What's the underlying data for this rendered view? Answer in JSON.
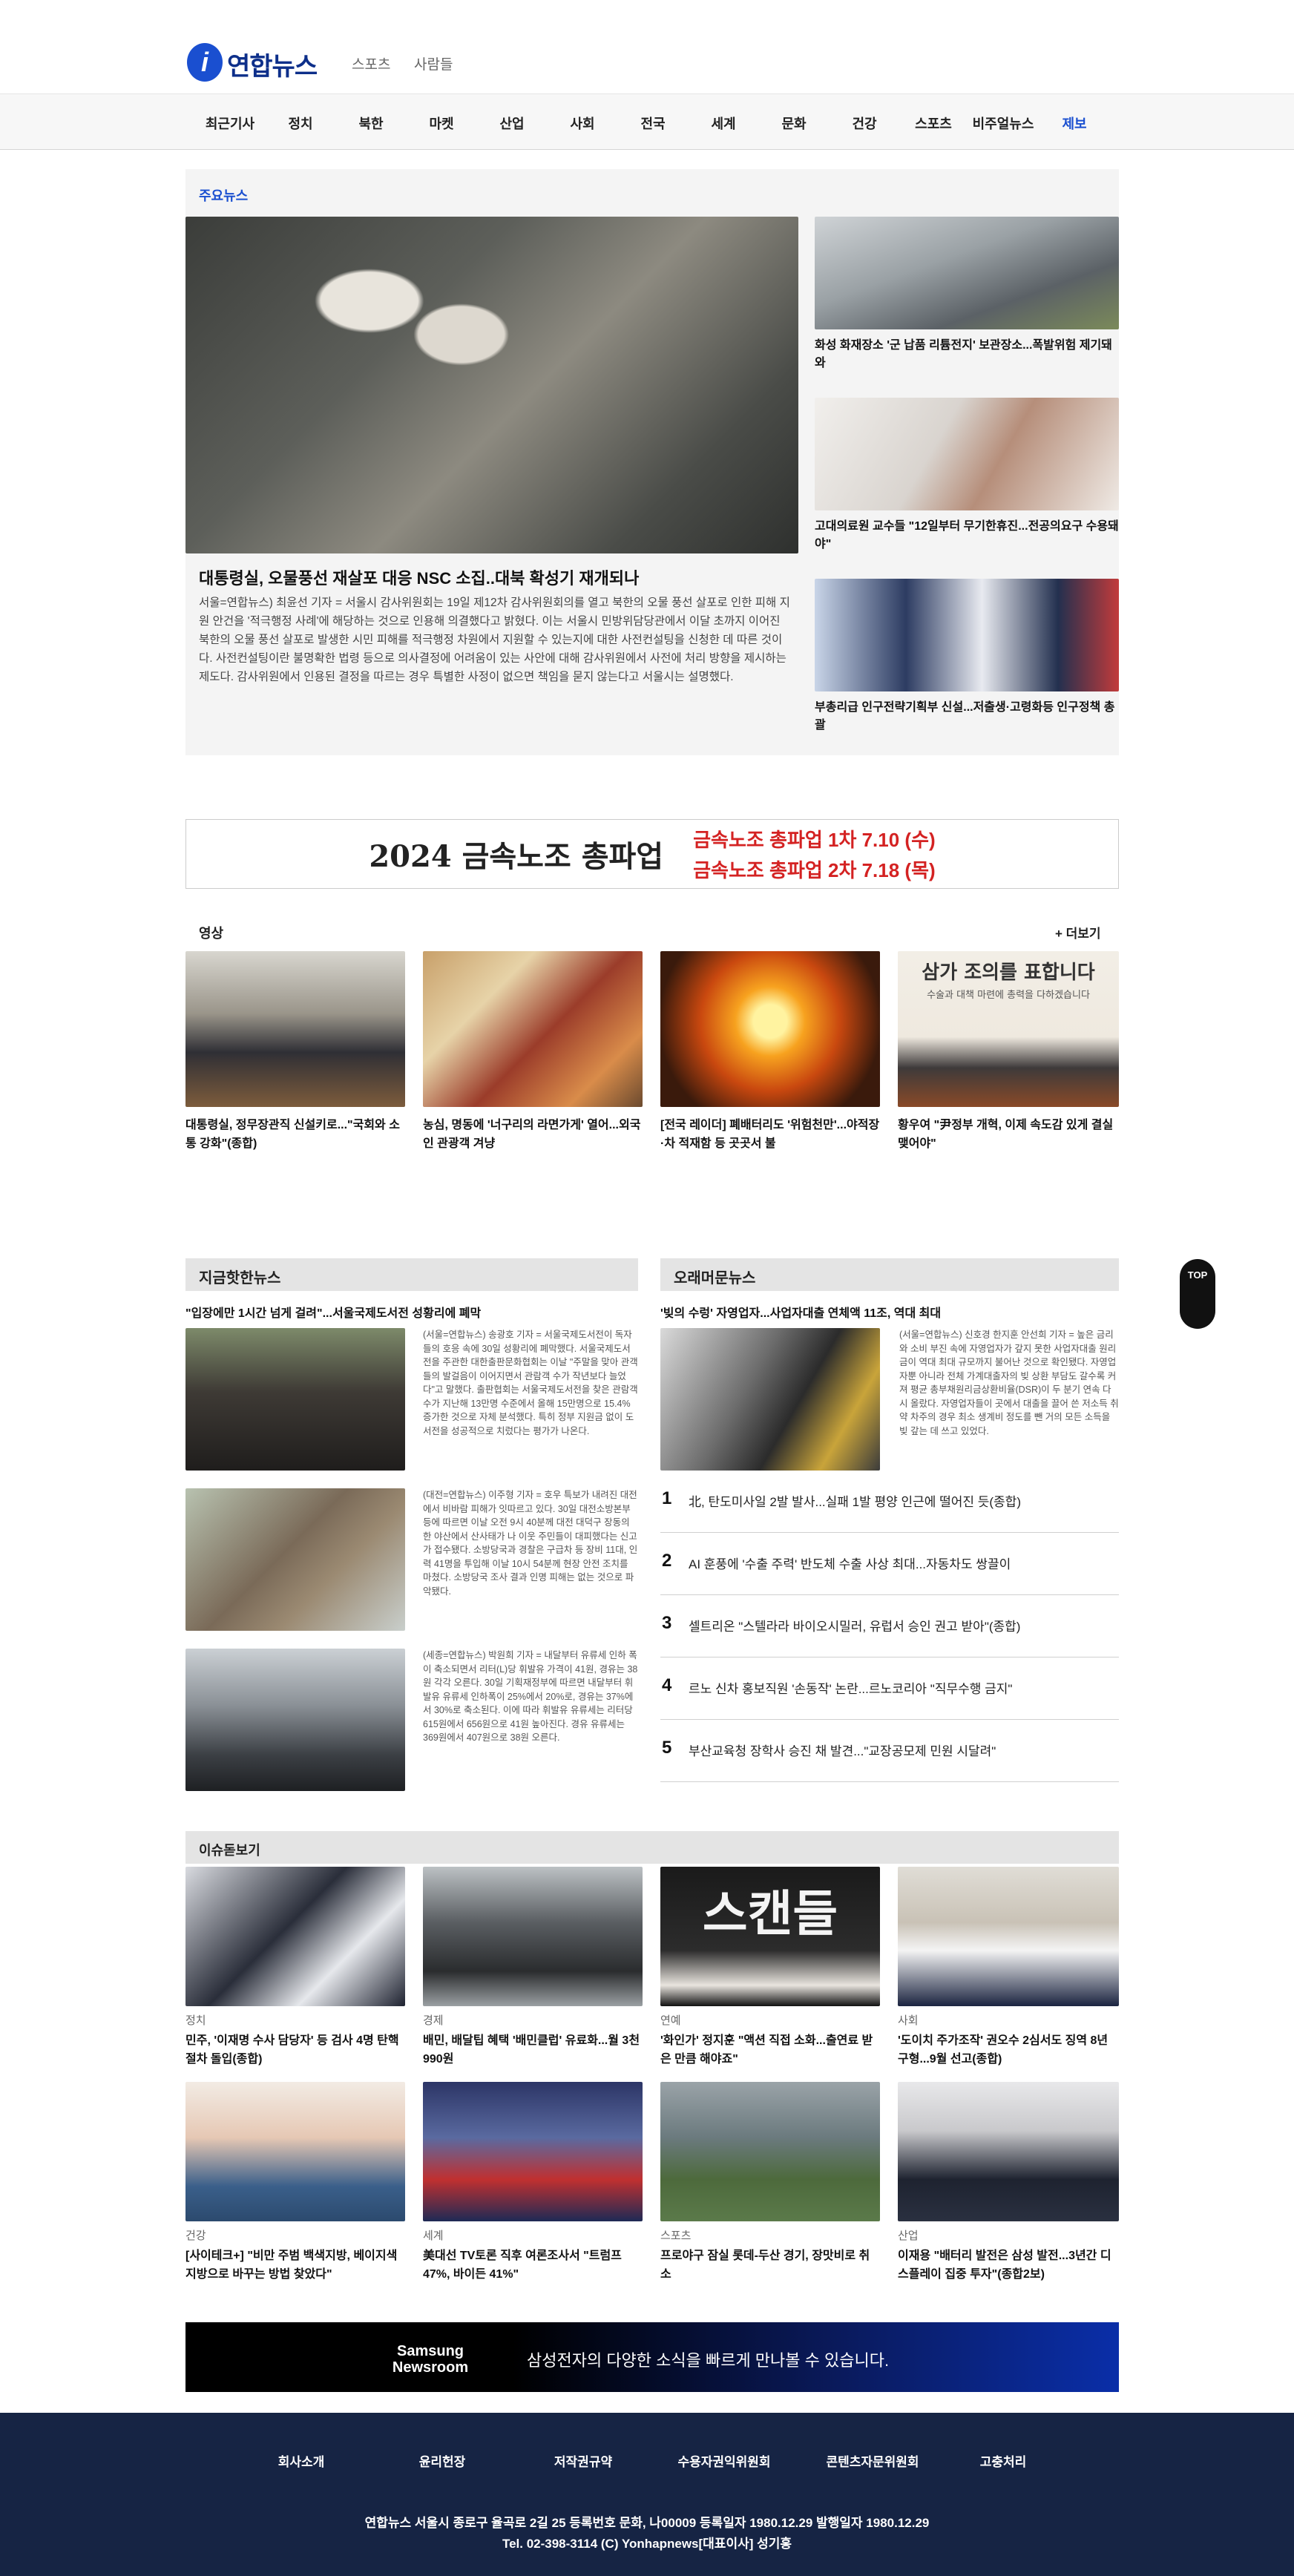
{
  "header": {
    "logo_text": "연합뉴스",
    "sub_links": [
      "스포츠",
      "사람들"
    ],
    "nav": [
      "최근기사",
      "정치",
      "북한",
      "마켓",
      "산업",
      "사회",
      "전국",
      "세계",
      "문화",
      "건강",
      "스포츠",
      "비주얼뉴스",
      "제보"
    ]
  },
  "main_news": {
    "label": "주요뉴스",
    "hero_title": "대통령실, 오물풍선 재살포 대응 NSC 소집..대북 확성기 재개되나",
    "hero_summary": "서울=연합뉴스) 최윤선 기자 = 서울시 감사위원회는 19일 제12차 감사위원회의를 열고 북한의 오물 풍선 살포로 인한 피해 지원 안건을 '적극행정 사례'에 해당하는 것으로 인용해 의결했다고 밝혔다. 이는 서울시 민방위담당관에서 이달 초까지 이어진 북한의 오물 풍선 살포로 발생한 시민 피해를 적극행정 차원에서 지원할 수 있는지에 대한 사전컨설팅을 신청한 데 따른 것이다. 사전컨설팅이란 불명확한 법령 등으로 의사결정에 어려움이 있는 사안에 대해 감사위원에서 사전에 처리 방향을 제시하는 제도다. 감사위원에서 인용된 결정을 따르는 경우 특별한 사정이 없으면 책임을 묻지 않는다고 서울시는 설명했다.",
    "side": [
      "화성 화재장소 '군 납품 리튬전지' 보관장소...폭발위험 제기돼와",
      "고대의료원 교수들 \"12일부터 무기한휴진...전공의요구 수용돼야\"",
      "부총리급 인구전략기획부 신설...저출생·고령화등 인구정책 총괄"
    ]
  },
  "banner": {
    "left": "2024 금속노조 총파업",
    "line1": "금속노조 총파업 1차 7.10 (수)",
    "line2": "금속노조 총파업 2차 7.18 (목)"
  },
  "video": {
    "label": "영상",
    "more": "+ 더보기",
    "items": [
      "대통령실, 정무장관직 신설키로...\"국회와 소통 강화\"(종합)",
      "농심, 명동에 '너구리의 라면가게' 열어...외국인 관광객 겨냥",
      "[전국 레이더] 폐배터리도 '위험천만'...야적장·차 적재함 등 곳곳서 불",
      "황우여 \"尹정부 개혁, 이제 속도감 있게 결실 맺어야\""
    ],
    "thumb4_caption": "삼가 조의를 표합니다",
    "thumb4_sub": "수술과 대책 마련에 총력을 다하겠습니다"
  },
  "hot": {
    "label": "지금핫한뉴스",
    "headline": "\"입장에만 1시간 넘게 걸려\"...서울국제도서전 성황리에 폐막",
    "texts": [
      "(서울=연합뉴스) 송광호 기자 = 서울국제도서전이 독자들의 호응 속에 30일 성황리에 폐막했다. 서울국제도서전을 주관한 대한출판문화협회는 이날 \"주말을 맞아 관객들의 발걸음이 이어지면서 관람객 수가 작년보다 늘었다\"고 말했다. 출판협회는 서울국제도서전을 찾은 관람객 수가 지난해 13만명 수준에서 올해 15만명으로 15.4% 증가한 것으로 자체 분석했다. 특히 정부 지원금 없이 도서전을 성공적으로 치렀다는 평가가 나온다.",
      "(대전=연합뉴스) 이주형 기자 = 호우 특보가 내려진 대전에서 비바람 피해가 잇따르고 있다. 30일 대전소방본부 등에 따르면 이날 오전 9시 40분께 대전 대덕구 장동의 한 야산에서 산사태가 나 이웃 주민들이 대피했다는 신고가 접수됐다. 소방당국과 경찰은 구급차 등 장비 11대, 인력 41명을 투입해 이날 10시 54분께 현장 안전 조치를 마쳤다. 소방당국 조사 결과 인명 피해는 없는 것으로 파악됐다.",
      "(세종=연합뉴스) 박원희 기자 = 내달부터 유류세 인하 폭이 축소되면서 리터(L)당 휘발유 가격이 41원, 경유는 38원 각각 오른다. 30일 기획재정부에 따르면 내달부터 휘발유 유류세 인하폭이 25%에서 20%로, 경유는 37%에서 30%로 축소된다. 이에 따라 휘발유 유류세는 리터당 615원에서 656원으로 41원 높아진다. 경유 유류세는 369원에서 407원으로 38원 오른다."
    ]
  },
  "popular": {
    "label": "오래머문뉴스",
    "headline": "'빚의 수렁' 자영업자...사업자대출 연체액 11조, 역대 최대",
    "summary": "(서울=연합뉴스) 신호경 한지훈 안선희 기자 = 높은 금리와 소비 부진 속에 자영업자가 갚지 못한 사업자대출 원리금이 역대 최대 규모까지 불어난 것으로 확인됐다. 자영업자뿐 아니라 전체 가계대출자의 빚 상환 부담도 갈수록 커져 평균 총부채원리금상환비율(DSR)이 두 분기 연속 다시 올랐다. 자영업자들이 곳에서 대출을 끌어 쓴 저소득 취약 차주의 경우 최소 생계비 정도를 뺀 거의 모든 소득을 빚 갚는 데 쓰고 있었다.",
    "ranks": [
      {
        "num": "1",
        "text": "北, 탄도미사일 2발 발사...실패 1발 평양 인근에 떨어진 듯(종합)"
      },
      {
        "num": "2",
        "text": "AI 훈풍에 '수출 주력' 반도체 수출 사상 최대...자동차도 쌍끌이"
      },
      {
        "num": "3",
        "text": "셀트리온 \"스텔라라 바이오시밀러, 유럽서 승인 권고 받아\"(종합)"
      },
      {
        "num": "4",
        "text": "르노 신차 홍보직원 '손동작' 논란...르노코리아 \"직무수행 금지\""
      },
      {
        "num": "5",
        "text": "부산교육청 장학사 승진 채 발견...\"교장공모제 민원 시달려\""
      }
    ]
  },
  "issue": {
    "label": "이슈돋보기",
    "items": [
      {
        "cat": "정치",
        "title": "민주, '이재명 수사 담당자' 등 검사 4명 탄핵 절차 돌입(종합)"
      },
      {
        "cat": "경제",
        "title": "배민, 배달팁 혜택 '배민클럽' 유료화...월 3천990원"
      },
      {
        "cat": "연예",
        "title": "'화인가' 정지훈 \"액션 직접 소화...출연료 받은 만큼 해야죠\""
      },
      {
        "cat": "사회",
        "title": "'도이치 주가조작' 권오수 2심서도 징역 8년 구형...9월 선고(종합)"
      },
      {
        "cat": "건강",
        "title": "[사이테크+] \"비만 주범 백색지방, 베이지색 지방으로 바꾸는 방법 찾았다\""
      },
      {
        "cat": "세계",
        "title": "美대선 TV토론 직후 여론조사서 \"트럼프 47%, 바이든 41%\""
      },
      {
        "cat": "스포츠",
        "title": "프로야구 잠실 롯데-두산 경기, 장맛비로 취소"
      },
      {
        "cat": "산업",
        "title": "이재용 \"배터리 발전은 삼성 발전...3년간 디스플레이 집중 투자\"(종합2보)"
      }
    ],
    "thumb3_text": "스캔들"
  },
  "samsung": {
    "brand_line1": "Samsung",
    "brand_line2": "Newsroom",
    "text": "삼성전자의 다양한 소식을 빠르게 만나볼 수 있습니다."
  },
  "top_button": "TOP",
  "footer": {
    "links": [
      "회사소개",
      "윤리헌장",
      "저작권규약",
      "수용자권익위원회",
      "콘텐츠자문위원회",
      "고충처리"
    ],
    "line1": "연합뉴스 서울시 종로구 율곡로 2길 25 등록번호 문화, 나00009 등록일자 1980.12.29 발행일자 1980.12.29",
    "line2": "Tel. 02-398-3114 (C) Yonhapnews[대표이사] 성기홍"
  },
  "colors": {
    "accent": "#1a4fd0",
    "footer_bg": "#162444",
    "banner_red": "#d42222"
  }
}
